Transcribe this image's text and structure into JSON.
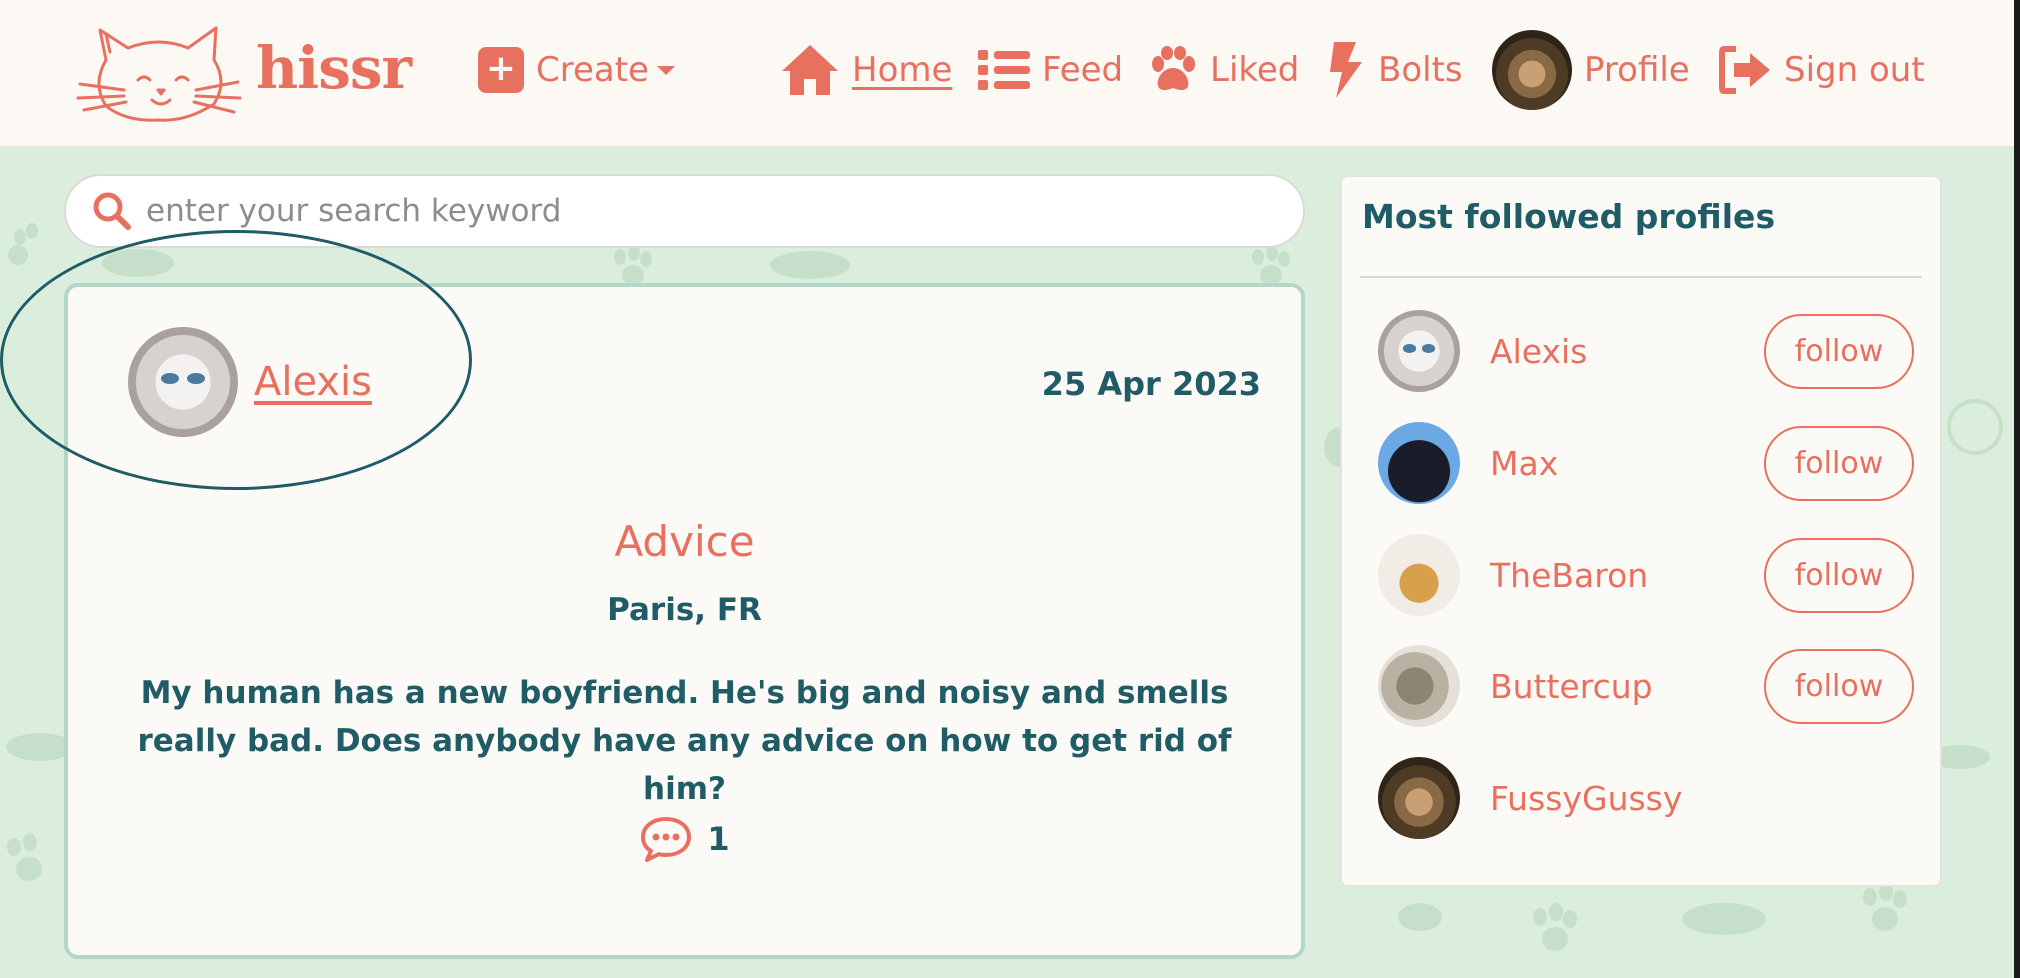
{
  "brand": {
    "name": "hissr",
    "logo_icon": "cat-face-logo-icon",
    "accent": "#e8705e",
    "teal": "#1f5c66"
  },
  "nav": {
    "create": "Create",
    "home": "Home",
    "feed": "Feed",
    "liked": "Liked",
    "bolts": "Bolts",
    "profile": "Profile",
    "signout": "Sign out"
  },
  "search": {
    "placeholder": "enter your search keyword",
    "value": ""
  },
  "post": {
    "author": "Alexis",
    "date": "25 Apr 2023",
    "title": "Advice",
    "location": "Paris, FR",
    "body": "My human has a new boyfriend. He's big and noisy and smells really bad. Does anybody have any advice on how to get rid of him?",
    "comment_count": "1"
  },
  "sidebar": {
    "title": "Most followed profiles",
    "follow_label": "follow",
    "profiles": [
      {
        "name": "Alexis",
        "avatar": "white-persian-cat"
      },
      {
        "name": "Max",
        "avatar": "black-cartoon-cat"
      },
      {
        "name": "TheBaron",
        "avatar": "baron-cat-figure"
      },
      {
        "name": "Buttercup",
        "avatar": "grey-tabby-cat"
      },
      {
        "name": "FussyGussy",
        "avatar": "tabby-cat-tongue"
      }
    ]
  }
}
